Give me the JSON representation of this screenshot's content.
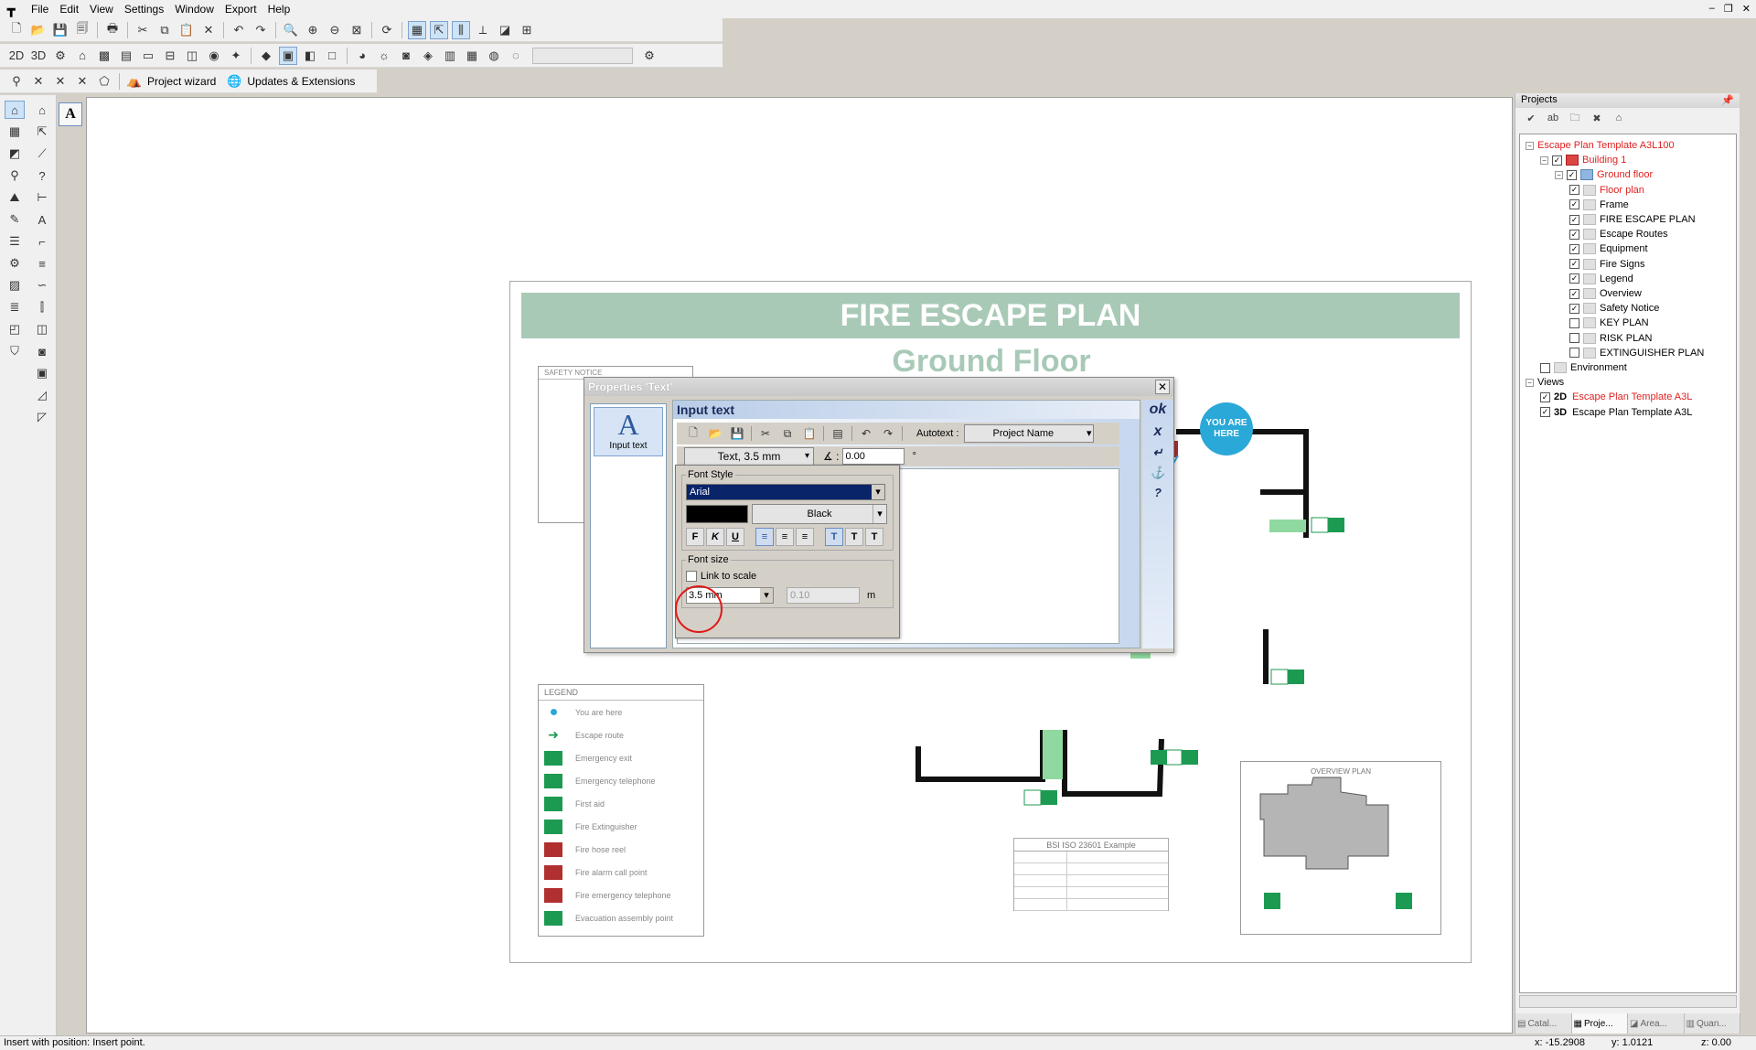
{
  "menu": [
    "File",
    "Edit",
    "View",
    "Settings",
    "Window",
    "Export",
    "Help"
  ],
  "toolbar3": {
    "project_wizard": "Project wizard",
    "updates": "Updates & Extensions"
  },
  "sheet": {
    "title": "FIRE ESCAPE PLAN",
    "subtitle": "Ground Floor",
    "safety_notice": "SAFETY NOTICE",
    "you_are_here": "YOU ARE HERE",
    "legend": {
      "title": "LEGEND",
      "items": [
        "You are here",
        "Escape route",
        "Emergency exit",
        "Emergency telephone",
        "First aid",
        "Fire Extinguisher",
        "Fire hose reel",
        "Fire alarm call point",
        "Fire emergency telephone",
        "Evacuation assembly point"
      ],
      "colors": [
        "#2aa8d8",
        "#1d9a52",
        "#1d9a52",
        "#1d9a52",
        "#1d9a52",
        "#1d9a52",
        "#b03030",
        "#b03030",
        "#b03030",
        "#1d9a52"
      ]
    },
    "overview": {
      "title": "OVERVIEW PLAN"
    },
    "titleblock": {
      "header": "BSI ISO 23601 Example"
    },
    "accent": "#a9c9b7"
  },
  "dialog": {
    "title": "Properties 'Text'",
    "left_item": "Input text",
    "header": "Input text",
    "autotext_label": "Autotext :",
    "autotext_value": "Project Name",
    "style_value": "Text, 3.5 mm",
    "angle_value": "0.00",
    "angle_unit": "°",
    "font_style_label": "Font Style",
    "font_value": "Arial",
    "color_value": "Black",
    "format_buttons": [
      "F",
      "K",
      "U"
    ],
    "font_size_label": "Font size",
    "link_to_scale": "Link to scale",
    "size_value": "3.5 mm",
    "size_m_value": "0.10",
    "size_unit": "m",
    "right_buttons": [
      "ok",
      "x",
      "↵",
      "⚓",
      "?"
    ]
  },
  "projects": {
    "title": "Projects",
    "tree": [
      {
        "label": "Escape Plan Template A3L100",
        "level": 0,
        "red": true,
        "exp": "−"
      },
      {
        "label": "Building 1",
        "level": 1,
        "red": true,
        "exp": "−",
        "check": "✓",
        "icon": "red"
      },
      {
        "label": "Ground floor",
        "level": 2,
        "red": true,
        "exp": "−",
        "check": "✓",
        "icon": "blue"
      },
      {
        "label": "Floor plan",
        "level": 3,
        "red": true,
        "check": "✓"
      },
      {
        "label": "Frame",
        "level": 3,
        "check": "✓"
      },
      {
        "label": "FIRE ESCAPE PLAN",
        "level": 3,
        "check": "✓"
      },
      {
        "label": "Escape Routes",
        "level": 3,
        "check": "✓"
      },
      {
        "label": "Equipment",
        "level": 3,
        "check": "✓"
      },
      {
        "label": "Fire Signs",
        "level": 3,
        "check": "✓"
      },
      {
        "label": "Legend",
        "level": 3,
        "check": "✓"
      },
      {
        "label": "Overview",
        "level": 3,
        "check": "✓"
      },
      {
        "label": "Safety Notice",
        "level": 3,
        "check": "✓"
      },
      {
        "label": "KEY PLAN",
        "level": 3,
        "check": ""
      },
      {
        "label": "RISK PLAN",
        "level": 3,
        "check": ""
      },
      {
        "label": "EXTINGUISHER PLAN",
        "level": 3,
        "check": ""
      },
      {
        "label": "Environment",
        "level": 1,
        "check": ""
      },
      {
        "label": "Views",
        "level": 0,
        "exp": "−"
      },
      {
        "label": "Escape Plan Template A3L",
        "level": 1,
        "tag": "2D",
        "red": true,
        "check": "✓"
      },
      {
        "label": "Escape Plan Template A3L",
        "level": 1,
        "tag": "3D",
        "check": "✓"
      }
    ],
    "tabs": [
      "Catal...",
      "Proje...",
      "Area...",
      "Quan..."
    ]
  },
  "status": {
    "message": "Insert with position: Insert point.",
    "x": "x: -15.2908",
    "y": "y: 1.0121",
    "z": "z: 0.00"
  }
}
